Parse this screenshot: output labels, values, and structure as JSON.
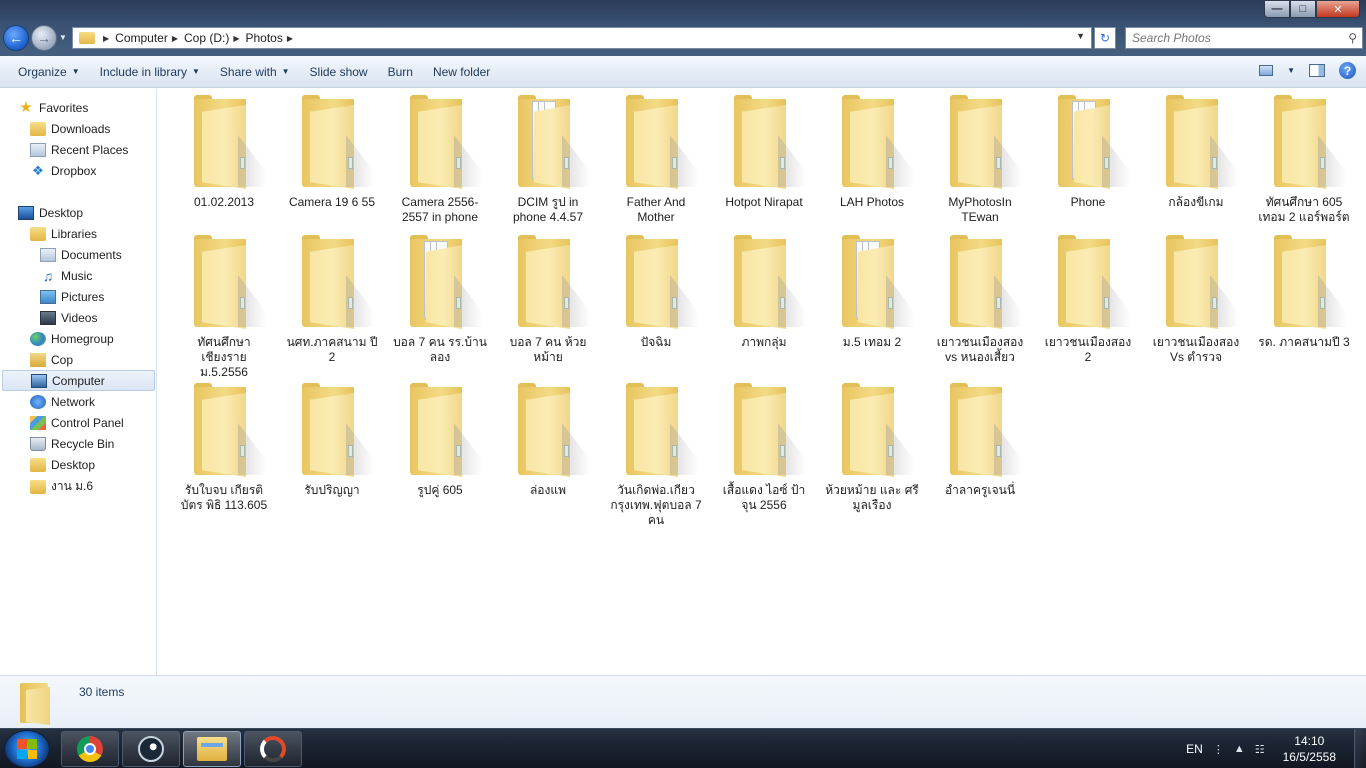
{
  "window": {
    "breadcrumb": [
      "Computer",
      "Cop (D:)",
      "Photos"
    ],
    "search_placeholder": "Search Photos"
  },
  "toolbar": {
    "organize": "Organize",
    "include_in_library": "Include in library",
    "share_with": "Share with",
    "slide_show": "Slide show",
    "burn": "Burn",
    "new_folder": "New folder"
  },
  "nav": {
    "favorites": "Favorites",
    "downloads": "Downloads",
    "recent_places": "Recent Places",
    "dropbox": "Dropbox",
    "desktop": "Desktop",
    "libraries": "Libraries",
    "documents": "Documents",
    "music": "Music",
    "pictures": "Pictures",
    "videos": "Videos",
    "homegroup": "Homegroup",
    "cop": "Cop",
    "computer": "Computer",
    "network": "Network",
    "control_panel": "Control Panel",
    "recycle_bin": "Recycle Bin",
    "desktop2": "Desktop",
    "ngan_m6": "งาน ม.6"
  },
  "folders": [
    {
      "name": "01.02.2013",
      "papers": false
    },
    {
      "name": "Camera 19 6 55",
      "papers": false
    },
    {
      "name": "Camera 2556-2557 in phone",
      "papers": false
    },
    {
      "name": "DCIM รูป in phone 4.4.57",
      "papers": true
    },
    {
      "name": "Father And Mother",
      "papers": false
    },
    {
      "name": "Hotpot Nirapat",
      "papers": false
    },
    {
      "name": "LAH Photos",
      "papers": false
    },
    {
      "name": "MyPhotosIn TEwan",
      "papers": false
    },
    {
      "name": "Phone",
      "papers": true
    },
    {
      "name": "กล้องขีเกม",
      "papers": false
    },
    {
      "name": "ทัศนศึกษา 605 เทอม 2 แอร์พอร์ต",
      "papers": false
    },
    {
      "name": "ทัศนศึกษาเชียงราย ม.5.2556",
      "papers": false
    },
    {
      "name": "นศท.ภาคสนาม ปี 2",
      "papers": false
    },
    {
      "name": "บอล 7 คน รร.บ้านลอง",
      "papers": true
    },
    {
      "name": "บอล 7 คน ห้วยหม้าย",
      "papers": false
    },
    {
      "name": "ปัจฉิม",
      "papers": false
    },
    {
      "name": "ภาพกลุ่ม",
      "papers": false
    },
    {
      "name": "ม.5 เทอม 2",
      "papers": true
    },
    {
      "name": "เยาวชนเมืองสอง vs หนองเสี้ยว",
      "papers": false
    },
    {
      "name": "เยาวชนเมืองสอง 2",
      "papers": false
    },
    {
      "name": "เยาวชนเมืองสอง Vs ตำรวจ",
      "papers": false
    },
    {
      "name": "รด. ภาคสนามปี 3",
      "papers": false
    },
    {
      "name": "รับใบจบ เกียรติบัตร พิธิ 113.605",
      "papers": false
    },
    {
      "name": "รับปริญญา",
      "papers": false
    },
    {
      "name": "รูปคู่ 605",
      "papers": false
    },
    {
      "name": "ล่องแพ",
      "papers": false
    },
    {
      "name": "วันเกิดพ่อ.เกียว กรุงเทพ.ฟุตบอล 7 คน",
      "papers": false
    },
    {
      "name": "เสื้อแดง ไอซ์ ป้าจุน 2556",
      "papers": false
    },
    {
      "name": "ห้วยหม้าย และ ศรีมูลเรือง",
      "papers": false
    },
    {
      "name": "อำลาครูเจนนี่",
      "papers": false
    }
  ],
  "details": {
    "count": "30 items"
  },
  "taskbar": {
    "lang": "EN",
    "time": "14:10",
    "date": "16/5/2558"
  }
}
